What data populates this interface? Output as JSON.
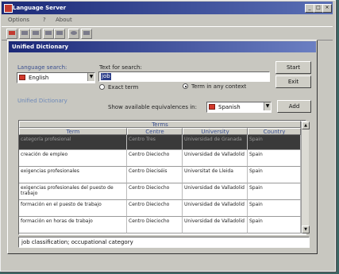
{
  "app": {
    "title": "Language Server"
  },
  "menu": [
    "Options",
    "?",
    "About"
  ],
  "dictionary": {
    "title": "Unified Dictionary",
    "language_search_label": "Language search:",
    "language_value": "English",
    "text_search_label": "Text for search:",
    "text_value": "job",
    "radio_exact": "Exact term",
    "radio_any": "Term in any context",
    "start_button": "Start",
    "exit_button": "Exit",
    "add_button": "Add",
    "section_label": "Unified Dictionary",
    "show_equiv_label": "Show available equivalences in:",
    "equiv_language": "Spanish"
  },
  "table": {
    "group_header": "Terms",
    "columns": [
      "Term",
      "Centre",
      "University",
      "Country"
    ],
    "rows": [
      [
        "categoría profesional",
        "Centro Tres",
        "Universidad de Granada",
        "Spain"
      ],
      [
        "creación de empleo",
        "Centro Dieciocho",
        "Universidad de Valladolid",
        "Spain"
      ],
      [
        "exigencias profesionales",
        "Centro Dieciséis",
        "Universitat de Lleida",
        "Spain"
      ],
      [
        "exigencias profesionales del puesto de trabajo",
        "Centro Dieciocho",
        "Universidad de Valladolid",
        "Spain"
      ],
      [
        "formación en el puesto de trabajo",
        "Centro Dieciocho",
        "Universidad de Valladolid",
        "Spain"
      ],
      [
        "formación en horas de trabajo",
        "Centro Dieciocho",
        "Universidad de Valladolid",
        "Spain"
      ]
    ]
  },
  "status": {
    "text": "job classification; occupational category"
  }
}
